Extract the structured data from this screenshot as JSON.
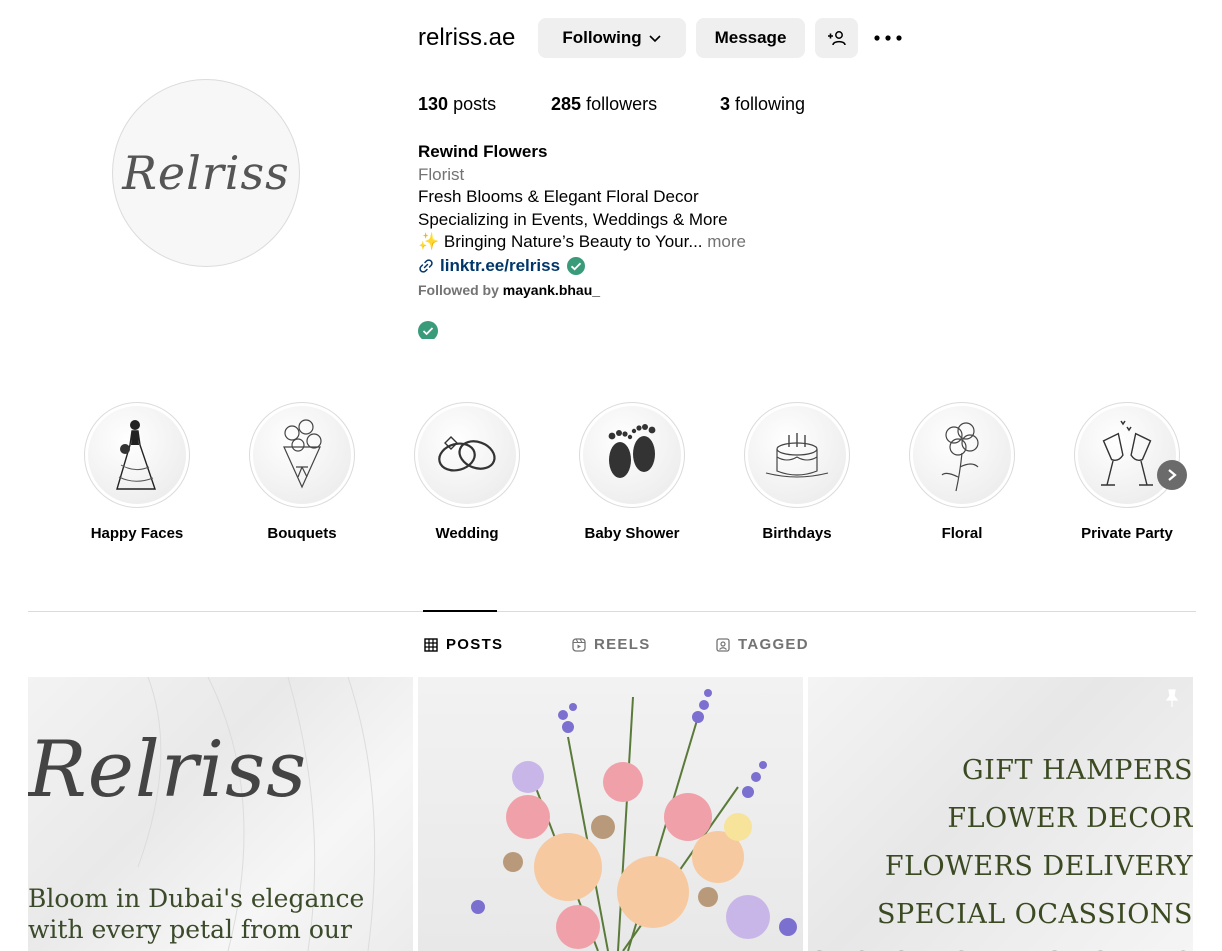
{
  "profile": {
    "username": "relriss.ae",
    "avatar_text": "Relriss",
    "following_label": "Following",
    "message_label": "Message",
    "stats": {
      "posts_count": "130",
      "posts_label": "posts",
      "followers_count": "285",
      "followers_label": "followers",
      "following_count": "3",
      "following_label": "following"
    },
    "bio": {
      "name": "Rewind Flowers",
      "category": "Florist",
      "line1": "Fresh Blooms & Elegant Floral Decor",
      "line2": "Specializing in Events, Weddings & More",
      "line3": "✨ Bringing Nature’s Beauty to Your...",
      "more_label": "more",
      "link": "linktr.ee/relriss",
      "followed_by_prefix": "Followed by",
      "followed_by_user": "mayank.bhau_"
    }
  },
  "highlights": [
    {
      "label": "Happy Faces",
      "icon": "bride-icon"
    },
    {
      "label": "Bouquets",
      "icon": "bouquet-icon"
    },
    {
      "label": "Wedding",
      "icon": "rings-icon"
    },
    {
      "label": "Baby Shower",
      "icon": "baby-feet-icon"
    },
    {
      "label": "Birthdays",
      "icon": "cake-icon"
    },
    {
      "label": "Floral",
      "icon": "flower-icon"
    },
    {
      "label": "Private Party",
      "icon": "champagne-icon"
    }
  ],
  "tabs": {
    "posts": "POSTS",
    "reels": "REELS",
    "tagged": "TAGGED"
  },
  "posts": {
    "p1_logo": "Relriss",
    "p1_line1": "Bloom in Dubai's elegance",
    "p1_line2": "with every petal from our",
    "p3_lines": [
      "GIFT HAMPERS",
      "FLOWER DECOR",
      "FLOWERS DELIVERY",
      "SPECIAL OCASSIONS",
      "CUSTOMISED BOUQUETS"
    ]
  },
  "colors": {
    "button_bg": "#efefef",
    "link": "#00376b",
    "verified": "#3a9b7a",
    "muted": "#737373"
  }
}
